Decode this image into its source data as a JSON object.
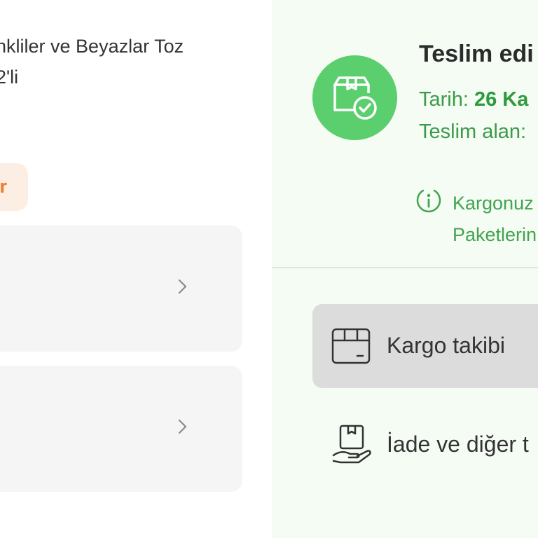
{
  "product": {
    "title_line1": "nkliler ve Beyazlar Toz",
    "title_line2": "2'li",
    "tag_label": "r"
  },
  "delivery": {
    "status_title": "Teslim edi",
    "date_label": "Tarih:",
    "date_value": "26 Ka",
    "receiver_label": "Teslim alan:",
    "info_line1": "Kargonuz",
    "info_line2": "Paketlerin"
  },
  "actions": {
    "cargo_tracking": "Kargo takibi",
    "return_other": "İade ve diğer t"
  },
  "colors": {
    "accent_green": "#5bce6d",
    "green_text": "#3c9a4a",
    "tag_orange": "#f07a2c",
    "panel_bg": "#f4fcf4"
  },
  "icons": {
    "status": "package-check-icon",
    "info": "info-icon",
    "cargo": "box-icon",
    "return": "hand-package-icon",
    "chevron": "chevron-right-icon"
  }
}
